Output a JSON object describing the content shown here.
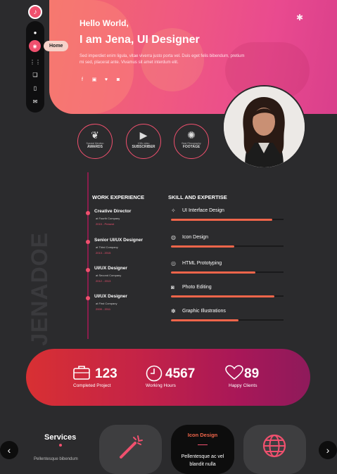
{
  "colors": {
    "accent": "#f0506e",
    "bar": "#f0654a"
  },
  "sidebar": {
    "logo_icon": "music-note-icon",
    "items": [
      {
        "icon": "user-icon"
      },
      {
        "icon": "home-icon",
        "label": "Home"
      },
      {
        "icon": "grid-icon"
      },
      {
        "icon": "chat-icon"
      },
      {
        "icon": "document-icon"
      },
      {
        "icon": "mail-icon"
      }
    ]
  },
  "hero": {
    "greeting": "Hello World,",
    "headline": "I am Jena, UI Designer",
    "description": "Sed imperdiet enim ligula, vitae viverra justo porta vel. Duis eget felis bibendum, pretium mi sed, placerat ante. Vivamus sit amet interdum elit.",
    "social": [
      "facebook-icon",
      "linkedin-icon",
      "twitter-icon",
      "instagram-icon"
    ]
  },
  "awards": [
    {
      "icon": "trophy-icon",
      "top": "Fun in Town",
      "sub": "Special Mention",
      "main": "AWARDS"
    },
    {
      "icon": "play-icon",
      "top": "",
      "sub": "100k video",
      "main": "SUBSCRIBER"
    },
    {
      "icon": "sparkle-icon",
      "top": "",
      "sub": "Best Filmography",
      "main": "FOOTAGE"
    }
  ],
  "watermark": "JENADOE",
  "work": {
    "title": "WORK EXPERIENCE",
    "items": [
      {
        "title": "Creative Director",
        "company": "at Fourth Company",
        "years": "2015 - Present"
      },
      {
        "title": "Senior UI/UX Designer",
        "company": "at Third Company",
        "years": "2013 - 2015"
      },
      {
        "title": "UI/UX Designer",
        "company": "at Second Company",
        "years": "2012 - 2013"
      },
      {
        "title": "UI/UX Designer",
        "company": "at First Company",
        "years": "2009 - 2011"
      }
    ]
  },
  "skills": {
    "title": "SKILL AND EXPERTISE",
    "items": [
      {
        "icon": "magic-wand-icon",
        "name": "UI Interface Design",
        "level": 0.9
      },
      {
        "icon": "palette-icon",
        "name": "Icon Design",
        "level": 0.56
      },
      {
        "icon": "globe-icon",
        "name": "HTML Prototyping",
        "level": 0.75
      },
      {
        "icon": "camera-icon",
        "name": "Photo Editing",
        "level": 0.92
      },
      {
        "icon": "flower-icon",
        "name": "Graphic Illustrations",
        "level": 0.6
      }
    ]
  },
  "stats": [
    {
      "icon": "briefcase-icon",
      "value": "123",
      "label": "Completed Project"
    },
    {
      "icon": "clock-icon",
      "value": "4567",
      "label": "Working Hours"
    },
    {
      "icon": "heart-icon",
      "value": "89",
      "label": "Happy Clients"
    }
  ],
  "services": {
    "title": "Services",
    "description": "Pellentesque bibendum",
    "cards": [
      {
        "icon": "magic-wand-icon",
        "title": "",
        "text": ""
      },
      {
        "icon": "",
        "title": "Icon Design",
        "text": "Pellentesque ac vel blandit nulla"
      },
      {
        "icon": "globe-icon",
        "title": "",
        "text": ""
      }
    ]
  },
  "nav": {
    "prev_icon": "chevron-left-icon",
    "next_icon": "chevron-right-icon"
  }
}
